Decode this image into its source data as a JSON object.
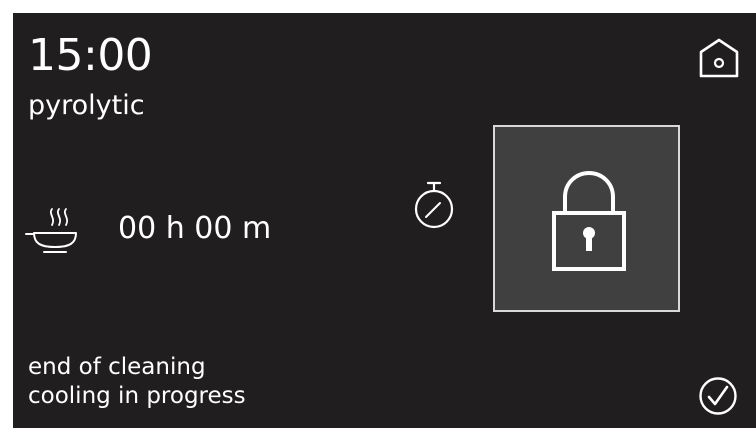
{
  "header": {
    "time": "15:00",
    "program": "pyrolytic"
  },
  "cooking": {
    "duration": "00 h 00 m"
  },
  "status": {
    "line1": "end of cleaning",
    "line2": "cooling in progress"
  },
  "icons": {
    "home": "home-icon",
    "pan": "steaming-pan-icon",
    "timer": "stopwatch-icon",
    "lock": "padlock-icon",
    "confirm": "check-circle-icon"
  },
  "colors": {
    "background": "#211e1f",
    "text": "#ffffff",
    "lock_panel": "#404040"
  }
}
